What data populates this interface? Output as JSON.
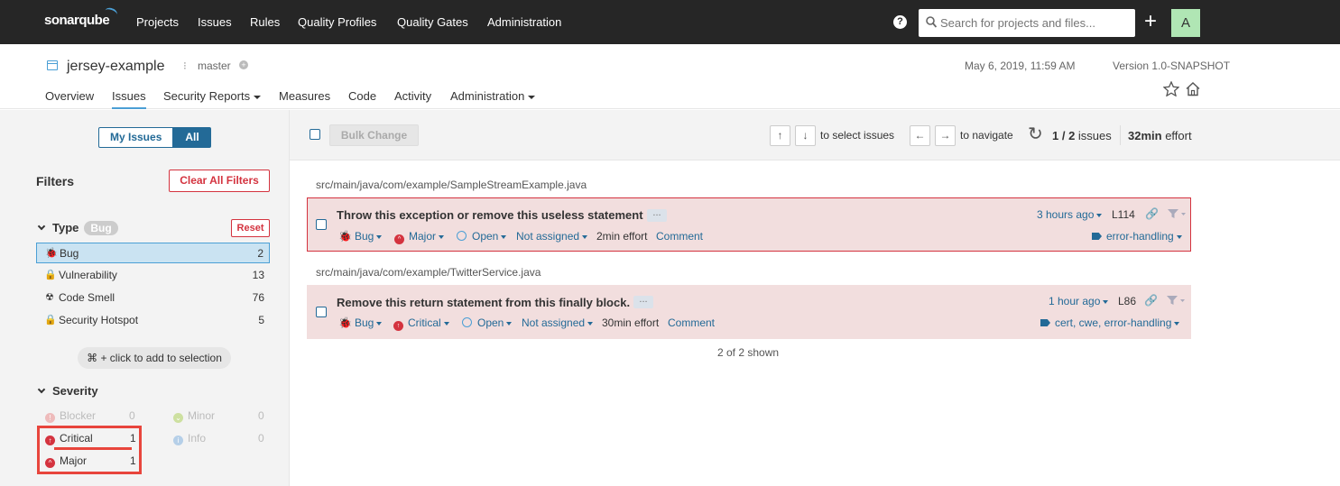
{
  "topnav": {
    "logo": "sonarqube",
    "links": [
      "Projects",
      "Issues",
      "Rules",
      "Quality Profiles",
      "Quality Gates",
      "Administration"
    ],
    "help": "?",
    "search_placeholder": "Search for projects and files...",
    "plus": "+",
    "avatar": "A"
  },
  "project": {
    "name": "jersey-example",
    "branch": "master",
    "date": "May 6, 2019, 11:59 AM",
    "version": "Version 1.0-SNAPSHOT",
    "tabs": [
      "Overview",
      "Issues",
      "Security Reports",
      "Measures",
      "Code",
      "Activity",
      "Administration"
    ]
  },
  "sidebar": {
    "toggle_my": "My Issues",
    "toggle_all": "All",
    "filters_title": "Filters",
    "clear_all": "Clear All Filters",
    "type_title": "Type",
    "type_pill": "Bug",
    "reset": "Reset",
    "types": [
      {
        "label": "Bug",
        "count": "2",
        "icon": "bug-icon"
      },
      {
        "label": "Vulnerability",
        "count": "13",
        "icon": "lock-icon"
      },
      {
        "label": "Code Smell",
        "count": "76",
        "icon": "radiation-icon"
      },
      {
        "label": "Security Hotspot",
        "count": "5",
        "icon": "lock-icon"
      }
    ],
    "hint": "⌘ + click to add to selection",
    "severity_title": "Severity",
    "severities": [
      {
        "label": "Blocker",
        "count": "0"
      },
      {
        "label": "Minor",
        "count": "0"
      },
      {
        "label": "Critical",
        "count": "1"
      },
      {
        "label": "Info",
        "count": "0"
      },
      {
        "label": "Major",
        "count": "1"
      }
    ]
  },
  "toolbar": {
    "bulk": "Bulk Change",
    "up": "↑",
    "down": "↓",
    "select_text": "to select issues",
    "left": "←",
    "right": "→",
    "nav_text": "to navigate",
    "count_bold": "1 / 2",
    "count_text": "issues",
    "effort_bold": "32min",
    "effort_text": "effort"
  },
  "issues": [
    {
      "file": "src/main/java/com/example/SampleStreamExample.java",
      "message": "Throw this exception or remove this useless statement",
      "type": "Bug",
      "severity": "Major",
      "status": "Open",
      "assignee": "Not assigned",
      "effort": "2min effort",
      "comment": "Comment",
      "age": "3 hours ago",
      "line": "L114",
      "tags": "error-handling"
    },
    {
      "file": "src/main/java/com/example/TwitterService.java",
      "message": "Remove this return statement from this finally block.",
      "type": "Bug",
      "severity": "Critical",
      "status": "Open",
      "assignee": "Not assigned",
      "effort": "30min effort",
      "comment": "Comment",
      "age": "1 hour ago",
      "line": "L86",
      "tags": "cert, cwe, error-handling"
    }
  ],
  "footer": {
    "shown": "2 of 2 shown"
  },
  "colors": {
    "topnav": "#262626",
    "accent": "#4b9fd5",
    "link": "#236a97",
    "error": "#d4333f",
    "issue_bg": "#f2dede",
    "highlight": "#e8453c"
  }
}
